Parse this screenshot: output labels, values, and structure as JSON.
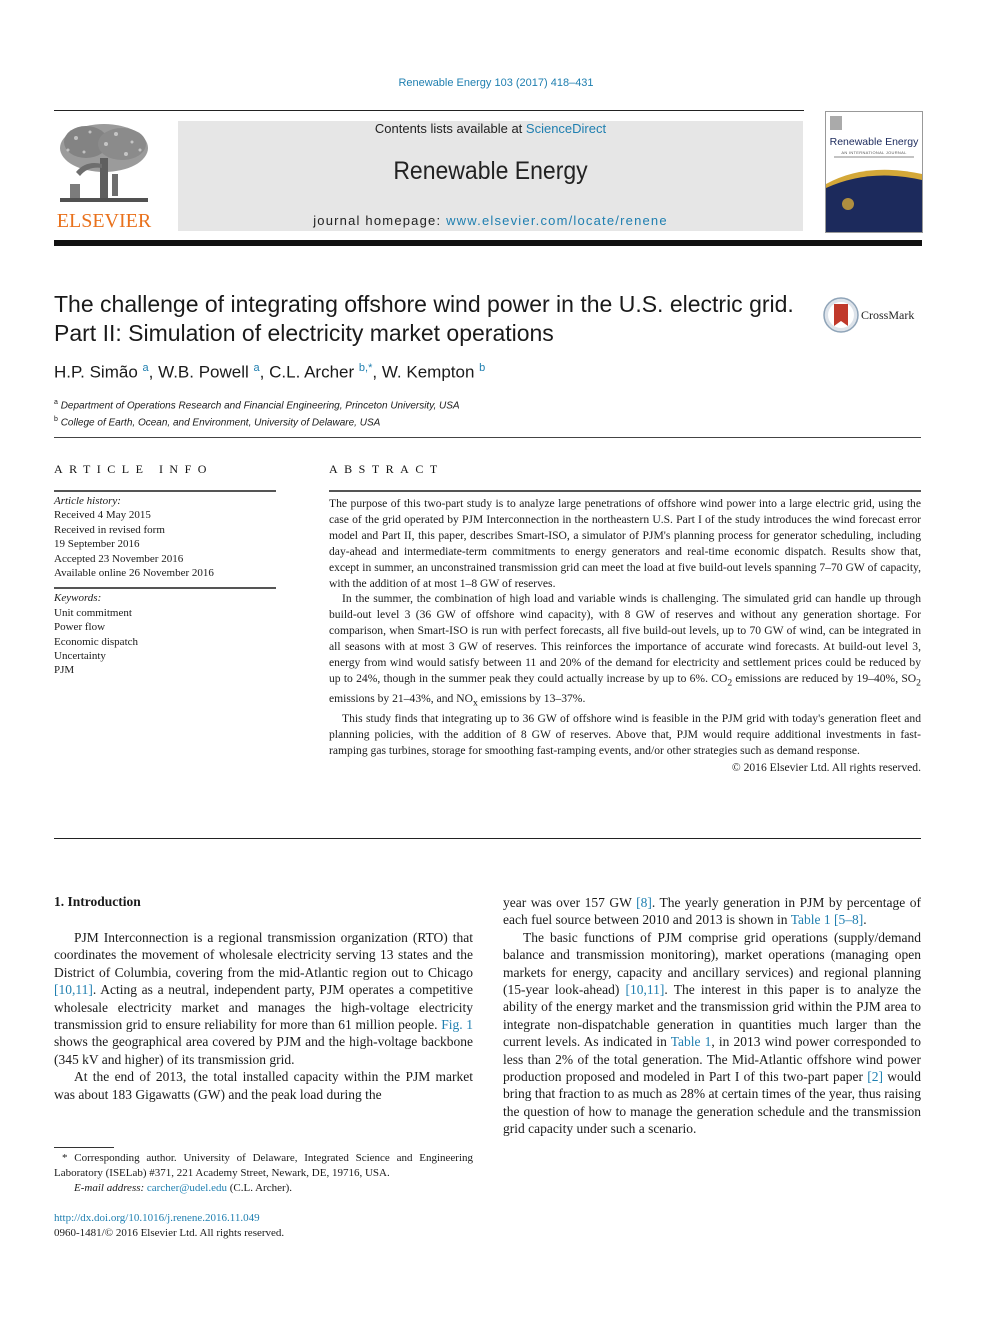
{
  "header": {
    "citation": "Renewable Energy 103 (2017) 418–431",
    "publisher_logo_text": "ELSEVIER",
    "contents_prefix": "Contents lists available at ",
    "contents_link": "ScienceDirect",
    "journal_name": "Renewable Energy",
    "homepage_prefix": "journal homepage: ",
    "homepage_link": "www.elsevier.com/locate/renene",
    "cover": {
      "title": "Renewable Energy",
      "subtitle": "AN INTERNATIONAL JOURNAL"
    },
    "crossmark_label": "CrossMark"
  },
  "article": {
    "title": "The challenge of integrating offshore wind power in the U.S. electric grid. Part II: Simulation of electricity market operations",
    "authors": [
      {
        "name": "H.P. Simão",
        "sup": "a"
      },
      {
        "name": "W.B. Powell",
        "sup": "a"
      },
      {
        "name": "C.L. Archer",
        "sup": "b,*"
      },
      {
        "name": "W. Kempton",
        "sup": "b"
      }
    ],
    "affiliations": [
      {
        "sup": "a",
        "text": "Department of Operations Research and Financial Engineering, Princeton University, USA"
      },
      {
        "sup": "b",
        "text": "College of Earth, Ocean, and Environment, University of Delaware, USA"
      }
    ]
  },
  "article_info": {
    "heading": "ARTICLE INFO",
    "history_label": "Article history:",
    "history": [
      "Received 4 May 2015",
      "Received in revised form",
      "19 September 2016",
      "Accepted 23 November 2016",
      "Available online 26 November 2016"
    ],
    "keywords_label": "Keywords:",
    "keywords": [
      "Unit commitment",
      "Power flow",
      "Economic dispatch",
      "Uncertainty",
      "PJM"
    ]
  },
  "abstract": {
    "heading": "ABSTRACT",
    "p1": "The purpose of this two-part study is to analyze large penetrations of offshore wind power into a large electric grid, using the case of the grid operated by PJM Interconnection in the northeastern U.S. Part I of the study introduces the wind forecast error model and Part II, this paper, describes Smart-ISO, a simulator of PJM's planning process for generator scheduling, including day-ahead and intermediate-term commitments to energy generators and real-time economic dispatch. Results show that, except in summer, an unconstrained transmission grid can meet the load at five build-out levels spanning 7–70 GW of capacity, with the addition of at most 1–8 GW of reserves.",
    "p2_a": "In the summer, the combination of high load and variable winds is challenging. The simulated grid can handle up through build-out level 3 (36 GW of offshore wind capacity), with 8 GW of reserves and without any generation shortage. For comparison, when Smart-ISO is run with perfect forecasts, all five build-out levels, up to 70 GW of wind, can be integrated in all seasons with at most 3 GW of reserves. This reinforces the importance of accurate wind forecasts. At build-out level 3, energy from wind would satisfy between 11 and 20% of the demand for electricity and settlement prices could be reduced by up to 24%, though in the summer peak they could actually increase by up to 6%. CO",
    "p2_b": " emissions are reduced by 19–40%, SO",
    "p2_c": " emissions by 21–43%, and NO",
    "p2_d": " emissions by 13–37%.",
    "sub_2": "2",
    "sub_x": "x",
    "p3": "This study finds that integrating up to 36 GW of offshore wind is feasible in the PJM grid with today's generation fleet and planning policies, with the addition of 8 GW of reserves. Above that, PJM would require additional investments in fast-ramping gas turbines, storage for smoothing fast-ramping events, and/or other strategies such as demand response.",
    "copyright": "© 2016 Elsevier Ltd. All rights reserved."
  },
  "body": {
    "section_heading": "1.  Introduction",
    "left_p1_a": "PJM Interconnection is a regional transmission organization (RTO) that coordinates the movement of wholesale electricity serving 13 states and the District of Columbia, covering from the mid-Atlantic region out to Chicago ",
    "left_p1_ref1": "[10,11]",
    "left_p1_b": ". Acting as a neutral, independent party, PJM operates a competitive wholesale electricity market and manages the high-voltage electricity transmission grid to ensure reliability for more than 61 million people. ",
    "left_p1_ref2": "Fig. 1",
    "left_p1_c": " shows the geographical area covered by PJM and the high-voltage backbone (345 kV and higher) of its transmission grid.",
    "left_p2": "At the end of 2013, the total installed capacity within the PJM market was about 183 Gigawatts (GW) and the peak load during the",
    "right_p1_a": "year was over 157 GW ",
    "right_p1_ref1": "[8]",
    "right_p1_b": ". The yearly generation in PJM by percentage of each fuel source between 2010 and 2013 is shown in ",
    "right_p1_ref2": "Table 1 [5–8]",
    "right_p1_c": ".",
    "right_p2_a": "The basic functions of PJM comprise grid operations (supply/demand balance and transmission monitoring), market operations (managing open markets for energy, capacity and ancillary services) and regional planning (15-year look-ahead) ",
    "right_p2_ref1": "[10,11]",
    "right_p2_b": ". The interest in this paper is to analyze the ability of the energy market and the transmission grid within the PJM area to integrate non-dispatchable generation in quantities much larger than the current levels. As indicated in ",
    "right_p2_ref2": "Table 1",
    "right_p2_c": ", in 2013 wind power corresponded to less than 2% of the total generation. The Mid-Atlantic offshore wind power production proposed and modeled in Part I of this two-part paper ",
    "right_p2_ref3": "[2]",
    "right_p2_d": " would bring that fraction to as much as 28% at certain times of the year, thus raising the question of how to manage the generation schedule and the transmission grid capacity under such a scenario."
  },
  "footnote": {
    "corresponding": "* Corresponding author. University of Delaware, Integrated Science and Engineering Laboratory (ISELab) #371, 221 Academy Street, Newark, DE, 19716, USA.",
    "email_label": "E-mail address: ",
    "email": "carcher@udel.edu",
    "email_suffix": " (C.L. Archer).",
    "doi": "http://dx.doi.org/10.1016/j.renene.2016.11.049",
    "issn": "0960-1481/© 2016 Elsevier Ltd. All rights reserved."
  },
  "colors": {
    "link": "#1f7fb0",
    "elsevier_orange": "#e9711c",
    "masthead_bg": "#e6e6e6",
    "cover_navy": "#1c2a5c",
    "cover_gold": "#d4a838",
    "crossmark_red": "#c0392b"
  }
}
